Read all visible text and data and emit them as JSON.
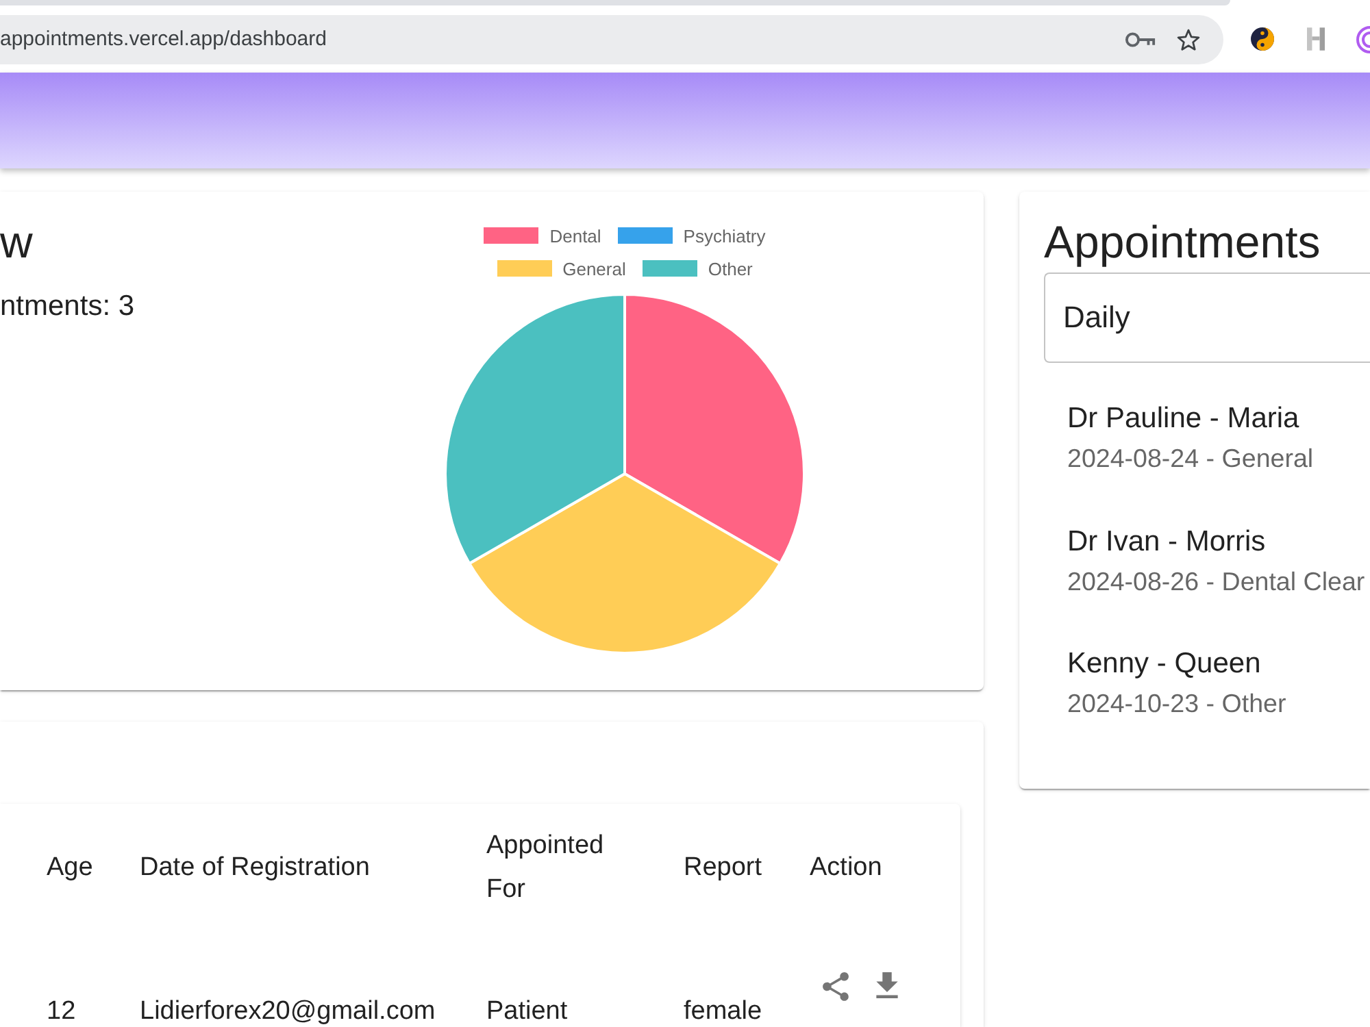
{
  "browser": {
    "url": "appointments.vercel.app/dashboard"
  },
  "overview": {
    "title": "w",
    "total": "ntments: 3",
    "chart_data": {
      "type": "pie",
      "categories": [
        "Dental",
        "Psychiatry",
        "General",
        "Other"
      ],
      "values": [
        33.33,
        0,
        33.33,
        33.34
      ],
      "colors": [
        "#ff6384",
        "#36a2eb",
        "#ffcd56",
        "#4bc0c0"
      ],
      "legend": "top"
    }
  },
  "appointments": {
    "title": "Appointments",
    "filter": {
      "value": "Daily"
    },
    "items": [
      {
        "primary": "Dr Pauline - Maria",
        "secondary": "2024-08-24 - General"
      },
      {
        "primary": "Dr Ivan - Morris",
        "secondary": "2024-08-26 - Dental Clear"
      },
      {
        "primary": "Kenny - Queen",
        "secondary": "2024-10-23 - Other"
      }
    ]
  },
  "table": {
    "columns": [
      "Age",
      "Date of Registration",
      "Appointed For",
      "Report",
      "Action"
    ],
    "rows": [
      {
        "cells": [
          "12",
          "Lidierforex20@gmail.com",
          "Patient",
          "female"
        ]
      }
    ]
  }
}
